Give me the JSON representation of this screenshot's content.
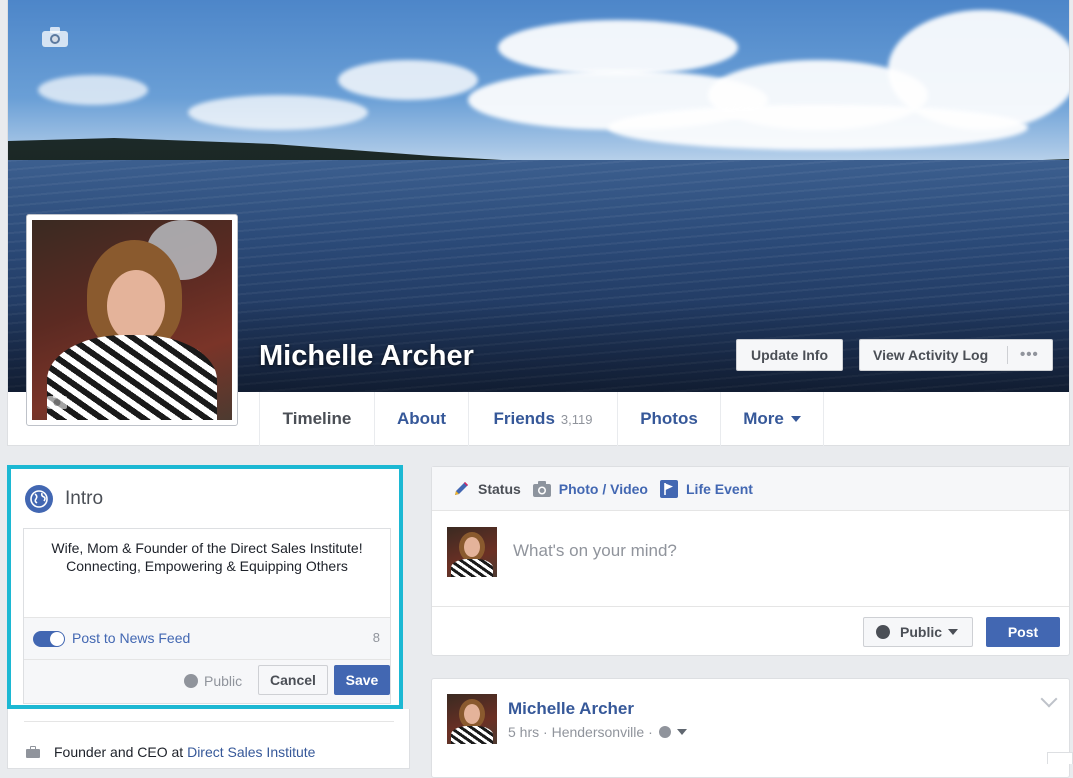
{
  "profile": {
    "name": "Michelle Archer",
    "update_info_label": "Update Info",
    "view_activity_log_label": "View Activity Log",
    "more_options_label": "•••"
  },
  "tabs": [
    {
      "label": "Timeline",
      "active": true
    },
    {
      "label": "About"
    },
    {
      "label": "Friends",
      "count": "3,119"
    },
    {
      "label": "Photos"
    },
    {
      "label": "More"
    }
  ],
  "intro": {
    "title": "Intro",
    "bio_text": "Wife, Mom & Founder of the Direct Sales Institute!\nConnecting, Empowering & Equipping Others",
    "post_to_feed_label": "Post to News Feed",
    "post_to_feed_enabled": true,
    "char_count": "8",
    "privacy_label": "Public",
    "cancel_label": "Cancel",
    "save_label": "Save",
    "work_prefix": "Founder and CEO at",
    "work_link": "Direct Sales Institute"
  },
  "composer": {
    "tabs": [
      {
        "label": "Status",
        "icon": "pencil-icon"
      },
      {
        "label": "Photo / Video",
        "icon": "camera-icon"
      },
      {
        "label": "Life Event",
        "icon": "flag-icon"
      }
    ],
    "placeholder": "What's on your mind?",
    "audience_label": "Public",
    "post_label": "Post"
  },
  "post": {
    "author": "Michelle Archer",
    "time": "5 hrs",
    "location": "Hendersonville"
  },
  "colors": {
    "accent": "#4267b2",
    "link": "#365899",
    "highlight_border": "#1cb8d3",
    "page_bg": "#e9ebee"
  }
}
